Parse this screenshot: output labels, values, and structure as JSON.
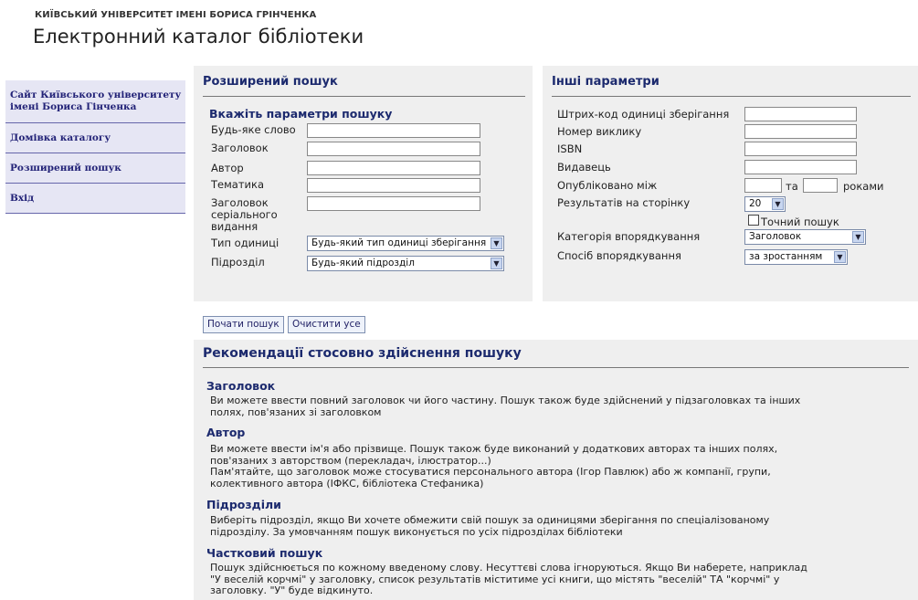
{
  "header": {
    "university": "КИЇВСЬКИЙ УНІВЕРСИТЕТ ІМЕНІ БОРИСА ГРІНЧЕНКА",
    "title": "Електронний каталог бібліотеки"
  },
  "sidebar": {
    "items": [
      {
        "label": "Сайт Київського університету імені Бориса Гінченка"
      },
      {
        "label": "Домівка каталогу"
      },
      {
        "label": "Розширений пошук"
      },
      {
        "label": "Вхід"
      }
    ]
  },
  "advanced": {
    "title": "Розширений пошук",
    "subtitle": "Вкажіть параметри пошуку",
    "fields": {
      "any_word": "Будь-яке слово",
      "title": "Заголовок",
      "author": "Автор",
      "subject": "Тематика",
      "serial_title": "Заголовок серіального видання",
      "item_type": "Тип одиниці",
      "branch": "Підрозділ"
    },
    "item_type_value": "Будь-який тип одиниці зберігання",
    "branch_value": "Будь-який підрозділ"
  },
  "other": {
    "title": "Інші параметри",
    "barcode": "Штрих-код одиниці зберігання",
    "call_number": "Номер виклику",
    "isbn": "ISBN",
    "publisher": "Видавець",
    "published_between": "Опубліковано між",
    "and": "та",
    "years": "роками",
    "results_per_page": "Результатів на сторінку",
    "results_value": "20",
    "exact_search": "Точний пошук",
    "sort_category": "Категорія впорядкування",
    "sort_category_value": "Заголовок",
    "sort_method": "Спосіб впорядкування",
    "sort_method_value": "за зростанням"
  },
  "buttons": {
    "search": "Почати пошук",
    "clear": "Очистити усе"
  },
  "recommendations": {
    "title": "Рекомендації стосовно здійснення пошуку",
    "sections": [
      {
        "heading": "Заголовок",
        "lines": [
          "Ви можете ввести повний заголовок чи його частину. Пошук також буде здійснений у підзаголовках та інших",
          "полях, пов'язаних зі заголовком"
        ]
      },
      {
        "heading": "Автор",
        "lines": [
          "Ви можете ввести ім'я або прізвище. Пошук також буде виконаний у додаткових авторах та інших полях,",
          "пов'язаних з авторством (перекладач, ілюстратор...)",
          "Пам'ятайте, що заголовок може стосуватися персонального автора (Ігор Павлюк) або ж компанії, групи,",
          "колективного автора (ІФКС, бібліотека Стефаника)"
        ]
      },
      {
        "heading": "Підрозділи",
        "lines": [
          "Виберіть підрозділ, якщо Ви хочете обмежити свій пошук за одиницями зберігання по спеціалізованому",
          "підрозділу. За умовчанням пошук виконується по усіх підрозділах бібліотеки"
        ]
      },
      {
        "heading": "Частковий пошук",
        "lines": [
          "Пошук здійснюється по кожному введеному слову. Несуттєві слова ігноруються. Якщо Ви наберете, наприклад",
          "\"У веселій корчмі\" у заголовку, список результатів міститиме усі книги, що містять \"веселій\" ТА \"корчмі\" у",
          "заголовку. \"У\" буде відкинуто."
        ]
      }
    ]
  }
}
